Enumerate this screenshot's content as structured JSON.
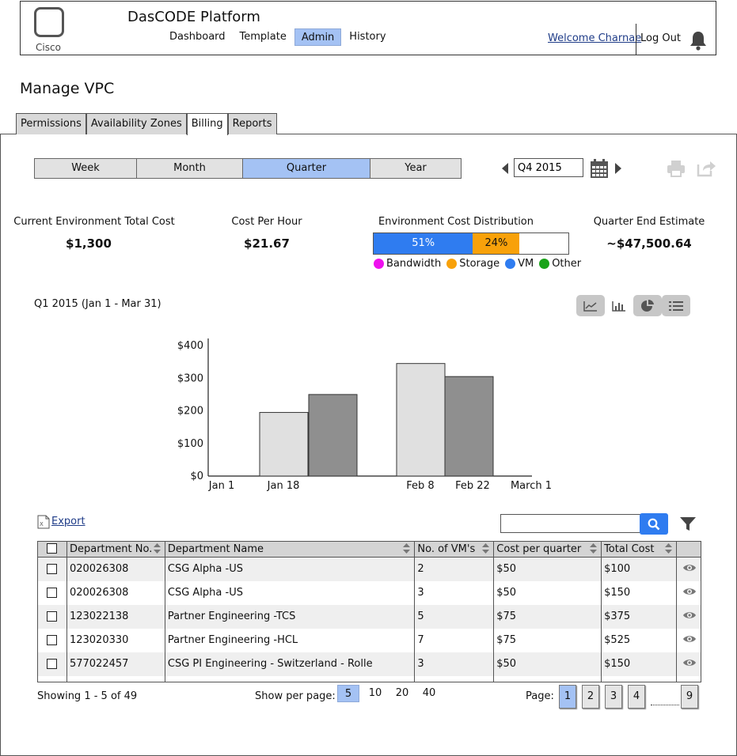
{
  "header": {
    "logo_text": "Cisco",
    "brand": "DasCODE Platform",
    "nav": [
      "Dashboard",
      "Template",
      "Admin",
      "History"
    ],
    "nav_active": "Admin",
    "welcome": "Welcome Charnae",
    "logout": "Log Out"
  },
  "page_title": "Manage VPC",
  "tabs": [
    "Permissions",
    "Availability Zones",
    "Billing",
    "Reports"
  ],
  "active_tab": "Billing",
  "period": {
    "options": [
      "Week",
      "Month",
      "Quarter",
      "Year"
    ],
    "active": "Quarter",
    "value": "Q4 2015"
  },
  "kpis": {
    "current_cost_label": "Current Environment Total Cost",
    "current_cost_value": "$1,300",
    "cost_per_hour_label": "Cost Per Hour",
    "cost_per_hour_value": "$21.67",
    "distribution_label": "Environment Cost Distribution",
    "distribution": [
      {
        "label": "51%",
        "percent": 51,
        "color": "#2f7cf0"
      },
      {
        "label": "24%",
        "percent": 24,
        "color": "#f8a10a"
      }
    ],
    "legend": [
      {
        "name": "Bandwidth",
        "color": "#ee11ee"
      },
      {
        "name": "Storage",
        "color": "#f8a10a"
      },
      {
        "name": "VM",
        "color": "#2f7cf0"
      },
      {
        "name": "Other",
        "color": "#19a319"
      }
    ],
    "estimate_label": "Quarter End Estimate",
    "estimate_value": "~$47,500.64"
  },
  "range_label": "Q1 2015 (Jan 1 - Mar 31)",
  "chart_data": {
    "type": "bar",
    "x_ticks": [
      "Jan 1",
      "Jan 18",
      "Feb 8",
      "Feb 22",
      "March 1"
    ],
    "y_ticks": [
      "$0",
      "$100",
      "$200",
      "$300",
      "$400"
    ],
    "ylim": [
      0,
      400
    ],
    "series": [
      {
        "values": [
          {
            "x": "Jan 18",
            "y": 195
          },
          {
            "x": "Feb 8",
            "y": 345
          }
        ],
        "color": "#e0e0e0"
      },
      {
        "values": [
          {
            "x": "Jan 18",
            "y": 250
          },
          {
            "x": "Feb 22",
            "y": 305
          }
        ],
        "color": "#8f8f8f"
      }
    ]
  },
  "table": {
    "export": "Export",
    "search_placeholder": "",
    "columns": [
      "Department No.",
      "Department Name",
      "No. of VM's",
      "Cost per quarter",
      "Total Cost"
    ],
    "rows": [
      [
        "020026308",
        "CSG Alpha -US",
        "2",
        "$50",
        "$100"
      ],
      [
        "020026308",
        "CSG Alpha -US",
        "3",
        "$50",
        "$150"
      ],
      [
        "123022138",
        "Partner Engineering -TCS",
        "5",
        "$75",
        "$375"
      ],
      [
        "123020330",
        "Partner Engineering -HCL",
        "7",
        "$75",
        "$525"
      ],
      [
        "577022457",
        "CSG PI Engineering - Switzerland - Rolle",
        "3",
        "$50",
        "$150"
      ]
    ]
  },
  "footer": {
    "showing": "Showing 1 - 5 of 49",
    "per_page_label": "Show per page:",
    "per_page": [
      "5",
      "10",
      "20",
      "40"
    ],
    "per_page_active": "5",
    "page_label": "Page:",
    "pages": [
      "1",
      "2",
      "3",
      "4"
    ],
    "last_page": "9",
    "active_page": "1"
  }
}
